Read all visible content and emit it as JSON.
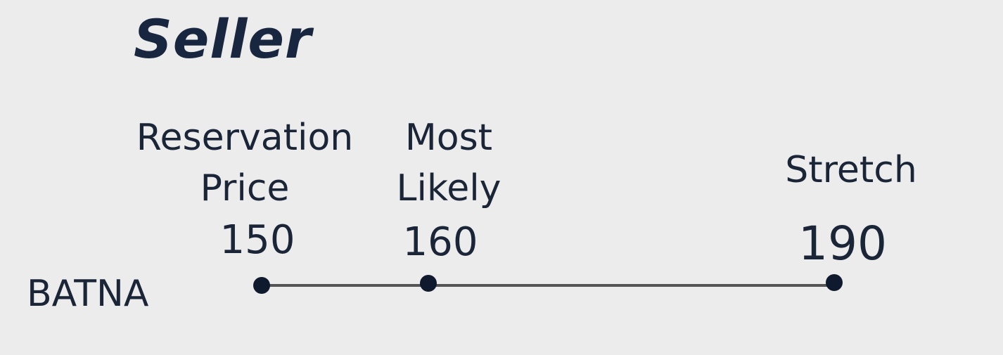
{
  "title": "Seller",
  "side_label": "BATNA",
  "points": [
    {
      "label_lines": [
        "Reservation",
        "Price"
      ],
      "value": "150"
    },
    {
      "label_lines": [
        "Most",
        "Likely"
      ],
      "value": "160"
    },
    {
      "label_lines": [
        "Stretch"
      ],
      "value": "190"
    }
  ],
  "colors": {
    "background": "#ececec",
    "text": "#1b2538",
    "line": "#555555",
    "dot": "#0f1a2e"
  }
}
